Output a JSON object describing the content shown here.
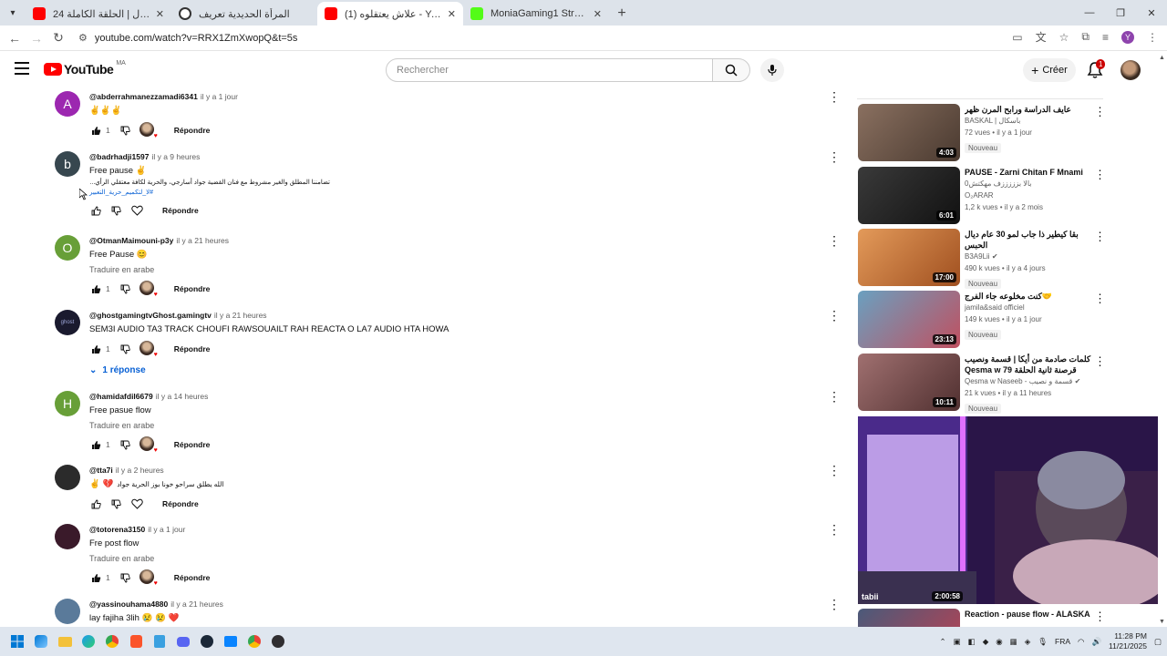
{
  "browser": {
    "tabs": [
      {
        "title": "قيامة أرطغرل | الحلقة الكاملة 24",
        "favicon_color": "#ff0000",
        "active": false
      },
      {
        "title": "المرأة الحديدية تعريف",
        "favicon_color": "#333333",
        "active": false
      },
      {
        "title": "(1) علاش يعتقلوه - YouTube",
        "favicon_color": "#ff0000",
        "active": true
      },
      {
        "title": "MoniaGaming1 Stream - Watch",
        "favicon_color": "#53fc18",
        "active": false
      }
    ],
    "new_tab_label": "+",
    "url": "youtube.com/watch?v=RRX1ZmXwopQ&t=5s",
    "profile_initial": "Y"
  },
  "header": {
    "country_code": "MA",
    "logo_text": "YouTube",
    "search_placeholder": "Rechercher",
    "create_label": "Créer",
    "notifications_count": "1"
  },
  "comments": [
    {
      "avatar_letter": "A",
      "avatar_color": "#9c27b0",
      "handle": "@abderrahmanezzamadi6341",
      "time": "il y a 1 jour",
      "text": "✌️✌️✌️",
      "text_ar": "",
      "translate": "",
      "likes": "1",
      "hearted": true,
      "reply_label": "Répondre",
      "replies": ""
    },
    {
      "avatar_letter": "b",
      "avatar_color": "#37474f",
      "handle": "@badrhadji1597",
      "time": "il y a 9 heures",
      "text": "Free pause ✌️",
      "text_ar": "تضامننا المطلق والغير مشروط مع فنان القضية جواد أسارجي، والحرية لكافة معتقلي الرأي...",
      "text_ar2": "#لا_لتكميم_حرية_التعبير",
      "translate": "",
      "likes": "",
      "hearted": false,
      "reply_label": "Répondre",
      "replies": ""
    },
    {
      "avatar_letter": "O",
      "avatar_color": "#689f38",
      "handle": "@OtmanMaimouni-p3y",
      "time": "il y a 21 heures",
      "text": "Free Pause 😊",
      "text_ar": "",
      "translate": "Traduire en arabe",
      "likes": "1",
      "hearted": true,
      "reply_label": "Répondre",
      "replies": ""
    },
    {
      "avatar_letter": "",
      "avatar_color": "#1a1a2e",
      "handle": "@ghostgamingtvGhost.gamingtv",
      "time": "il y a 21 heures",
      "text": "SEM3I AUDIO TA3 TRACK CHOUFI RAWSOUAILT RAH REACTA O LA7 AUDIO HTA HOWA",
      "text_ar": "",
      "translate": "",
      "likes": "1",
      "hearted": true,
      "reply_label": "Répondre",
      "replies": "1 réponse"
    },
    {
      "avatar_letter": "H",
      "avatar_color": "#689f38",
      "handle": "@hamidafdil6679",
      "time": "il y a 14 heures",
      "text": "Free pasue flow",
      "text_ar": "",
      "translate": "Traduire en arabe",
      "likes": "1",
      "hearted": true,
      "reply_label": "Répondre",
      "replies": ""
    },
    {
      "avatar_letter": "",
      "avatar_color": "#2b2b2b",
      "handle": "@tta7i",
      "time": "il y a 2 heures",
      "text": "✌️ 💔",
      "text_ar": "الله يطلق سراحو خونا بوز الحرية جواد",
      "translate": "",
      "likes": "",
      "hearted": false,
      "reply_label": "Répondre",
      "replies": ""
    },
    {
      "avatar_letter": "",
      "avatar_color": "#3a1a2a",
      "handle": "@totorena3150",
      "time": "il y a 1 jour",
      "text": "Fre post flow",
      "text_ar": "",
      "translate": "Traduire en arabe",
      "likes": "1",
      "hearted": true,
      "reply_label": "Répondre",
      "replies": ""
    },
    {
      "avatar_letter": "",
      "avatar_color": "#5a7a9a",
      "handle": "@yassinouhama4880",
      "time": "il y a 21 heures",
      "text": "lay fajiha 3lih 😢 😢 ❤️",
      "text_ar": "",
      "translate": "",
      "likes": "",
      "hearted": false,
      "reply_label": "",
      "replies": ""
    }
  ],
  "sidebar": {
    "videos": [
      {
        "title": "عايف الدراسة ورابح المرن ظهر",
        "channel": "BASKAL | باسكال",
        "views": "72 vues",
        "age": "il y a 1 jour",
        "badge": "Nouveau",
        "duration": "4:03",
        "thumb_color": "#6b5a4e"
      },
      {
        "title": "PAUSE - Zarni Chitan F Mnami",
        "channel": "0بالا بزززززف مهكتش",
        "channel2": "O₂ARAR",
        "views": "1,2 k vues",
        "age": "il y a 2 mois",
        "badge": "",
        "duration": "6:01",
        "thumb_color": "#2c2c2c"
      },
      {
        "title": "بقا كيطير ذا جاب لمو 30 عام ديال الحبس",
        "channel": "B3A9Lii",
        "views": "490 k vues",
        "age": "il y a 4 jours",
        "badge": "Nouveau",
        "duration": "17:00",
        "thumb_color": "#e07a2a"
      },
      {
        "title": "🤝كنت مخلوعه جاء الفرج",
        "channel": "jamila&said officiel",
        "views": "149 k vues",
        "age": "il y a 1 jour",
        "badge": "Nouveau",
        "duration": "23:13",
        "thumb_color": "#5a8fb0"
      },
      {
        "title": "كلمات صادمة من أيكا | قسمة ونصيب قرصنة ثانية الحلقة 79 Qesma w Naseeb",
        "channel": "Qesma w Naseeb - قسمة و نصيب",
        "views": "21 k vues",
        "age": "il y a 11 heures",
        "badge": "Nouveau",
        "duration": "10:11",
        "thumb_color": "#8a5a5a"
      },
      {
        "title": "Reaction - pause flow - ALASKA",
        "channel": "",
        "views": "",
        "age": "",
        "badge": "",
        "duration": "",
        "thumb_color": "#3a4a6a"
      }
    ],
    "player": {
      "brand": "tabii",
      "duration": "2:00:58"
    }
  },
  "taskbar": {
    "language": "FRA",
    "time": "11:28 PM",
    "date": "11/21/2025"
  }
}
